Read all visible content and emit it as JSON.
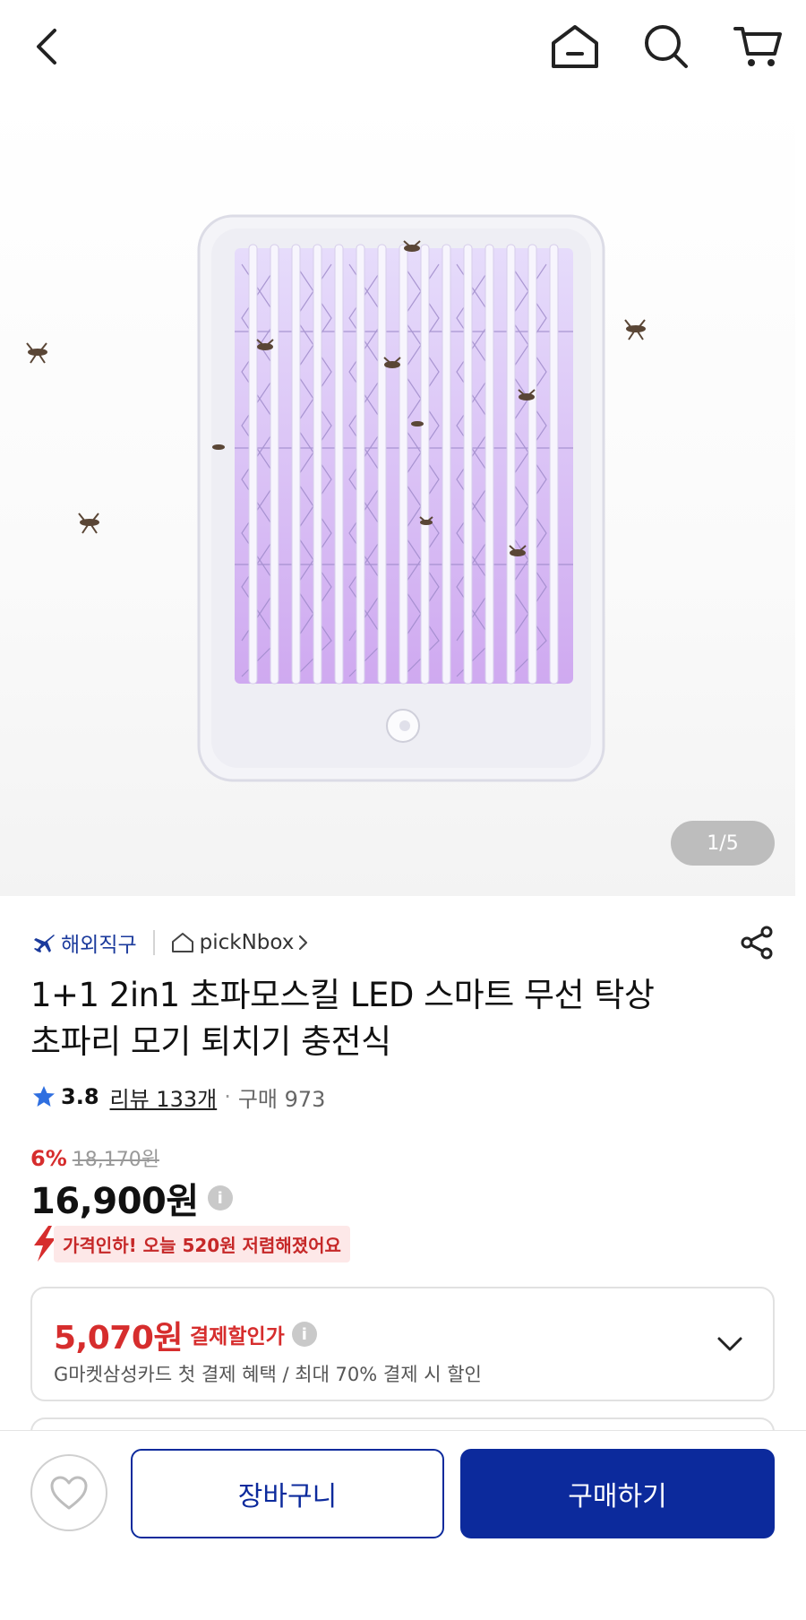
{
  "header": {
    "icons": [
      "back-arrow-icon",
      "home-icon",
      "search-icon",
      "cart-icon"
    ]
  },
  "gallery": {
    "counter": "1/5",
    "current": 1,
    "total": 5
  },
  "seller": {
    "badge": "해외직구",
    "shop_name": "pickNbox"
  },
  "product": {
    "title_line1": "1+1 2in1 초파모스킬 LED 스마트 무선 탁상",
    "title_line2": "초파리 모기 퇴치기 충전식",
    "rating": "3.8",
    "reviews": "리뷰 133개",
    "purchases": "구매 973",
    "discount_rate": "6%",
    "original_price": "18,170원",
    "price": "16,900원",
    "price_info": "i",
    "price_drop_notice": "가격인하! 오늘 520원 저렴해졌어요"
  },
  "coupon": {
    "amount": "5,070원",
    "label": "결제할인가",
    "info": "i",
    "description": "G마켓삼성카드 첫 결제 혜택 / 최대 70% 결제 시 할인"
  },
  "actions": {
    "cart_label": "장바구니",
    "buy_label": "구매하기"
  },
  "colors": {
    "primary": "#0c2a9c",
    "discount_red": "#d62d2d",
    "star": "#2f6fe0"
  }
}
